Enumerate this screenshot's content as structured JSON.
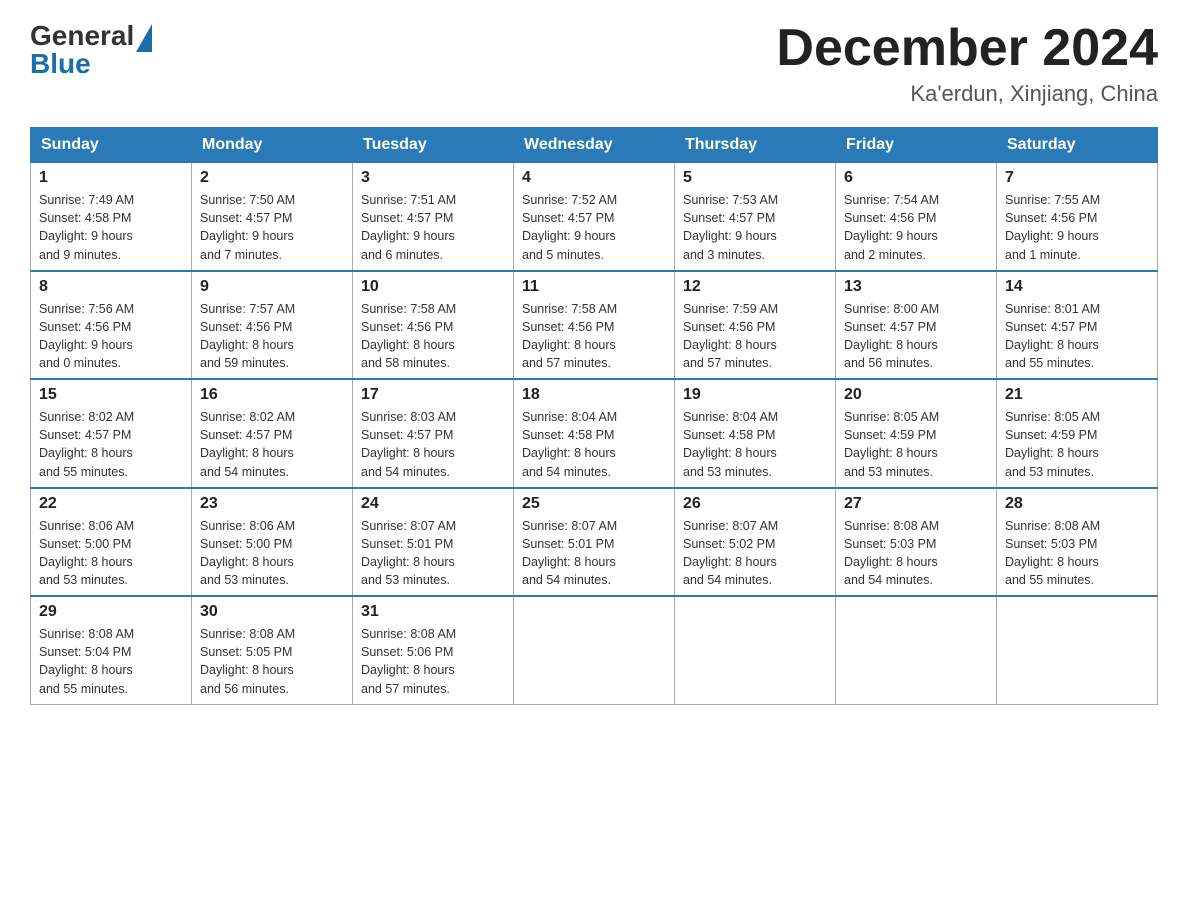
{
  "logo": {
    "general": "General",
    "blue": "Blue"
  },
  "title": "December 2024",
  "subtitle": "Ka'erdun, Xinjiang, China",
  "days_of_week": [
    "Sunday",
    "Monday",
    "Tuesday",
    "Wednesday",
    "Thursday",
    "Friday",
    "Saturday"
  ],
  "weeks": [
    [
      {
        "day": "1",
        "info": "Sunrise: 7:49 AM\nSunset: 4:58 PM\nDaylight: 9 hours\nand 9 minutes."
      },
      {
        "day": "2",
        "info": "Sunrise: 7:50 AM\nSunset: 4:57 PM\nDaylight: 9 hours\nand 7 minutes."
      },
      {
        "day": "3",
        "info": "Sunrise: 7:51 AM\nSunset: 4:57 PM\nDaylight: 9 hours\nand 6 minutes."
      },
      {
        "day": "4",
        "info": "Sunrise: 7:52 AM\nSunset: 4:57 PM\nDaylight: 9 hours\nand 5 minutes."
      },
      {
        "day": "5",
        "info": "Sunrise: 7:53 AM\nSunset: 4:57 PM\nDaylight: 9 hours\nand 3 minutes."
      },
      {
        "day": "6",
        "info": "Sunrise: 7:54 AM\nSunset: 4:56 PM\nDaylight: 9 hours\nand 2 minutes."
      },
      {
        "day": "7",
        "info": "Sunrise: 7:55 AM\nSunset: 4:56 PM\nDaylight: 9 hours\nand 1 minute."
      }
    ],
    [
      {
        "day": "8",
        "info": "Sunrise: 7:56 AM\nSunset: 4:56 PM\nDaylight: 9 hours\nand 0 minutes."
      },
      {
        "day": "9",
        "info": "Sunrise: 7:57 AM\nSunset: 4:56 PM\nDaylight: 8 hours\nand 59 minutes."
      },
      {
        "day": "10",
        "info": "Sunrise: 7:58 AM\nSunset: 4:56 PM\nDaylight: 8 hours\nand 58 minutes."
      },
      {
        "day": "11",
        "info": "Sunrise: 7:58 AM\nSunset: 4:56 PM\nDaylight: 8 hours\nand 57 minutes."
      },
      {
        "day": "12",
        "info": "Sunrise: 7:59 AM\nSunset: 4:56 PM\nDaylight: 8 hours\nand 57 minutes."
      },
      {
        "day": "13",
        "info": "Sunrise: 8:00 AM\nSunset: 4:57 PM\nDaylight: 8 hours\nand 56 minutes."
      },
      {
        "day": "14",
        "info": "Sunrise: 8:01 AM\nSunset: 4:57 PM\nDaylight: 8 hours\nand 55 minutes."
      }
    ],
    [
      {
        "day": "15",
        "info": "Sunrise: 8:02 AM\nSunset: 4:57 PM\nDaylight: 8 hours\nand 55 minutes."
      },
      {
        "day": "16",
        "info": "Sunrise: 8:02 AM\nSunset: 4:57 PM\nDaylight: 8 hours\nand 54 minutes."
      },
      {
        "day": "17",
        "info": "Sunrise: 8:03 AM\nSunset: 4:57 PM\nDaylight: 8 hours\nand 54 minutes."
      },
      {
        "day": "18",
        "info": "Sunrise: 8:04 AM\nSunset: 4:58 PM\nDaylight: 8 hours\nand 54 minutes."
      },
      {
        "day": "19",
        "info": "Sunrise: 8:04 AM\nSunset: 4:58 PM\nDaylight: 8 hours\nand 53 minutes."
      },
      {
        "day": "20",
        "info": "Sunrise: 8:05 AM\nSunset: 4:59 PM\nDaylight: 8 hours\nand 53 minutes."
      },
      {
        "day": "21",
        "info": "Sunrise: 8:05 AM\nSunset: 4:59 PM\nDaylight: 8 hours\nand 53 minutes."
      }
    ],
    [
      {
        "day": "22",
        "info": "Sunrise: 8:06 AM\nSunset: 5:00 PM\nDaylight: 8 hours\nand 53 minutes."
      },
      {
        "day": "23",
        "info": "Sunrise: 8:06 AM\nSunset: 5:00 PM\nDaylight: 8 hours\nand 53 minutes."
      },
      {
        "day": "24",
        "info": "Sunrise: 8:07 AM\nSunset: 5:01 PM\nDaylight: 8 hours\nand 53 minutes."
      },
      {
        "day": "25",
        "info": "Sunrise: 8:07 AM\nSunset: 5:01 PM\nDaylight: 8 hours\nand 54 minutes."
      },
      {
        "day": "26",
        "info": "Sunrise: 8:07 AM\nSunset: 5:02 PM\nDaylight: 8 hours\nand 54 minutes."
      },
      {
        "day": "27",
        "info": "Sunrise: 8:08 AM\nSunset: 5:03 PM\nDaylight: 8 hours\nand 54 minutes."
      },
      {
        "day": "28",
        "info": "Sunrise: 8:08 AM\nSunset: 5:03 PM\nDaylight: 8 hours\nand 55 minutes."
      }
    ],
    [
      {
        "day": "29",
        "info": "Sunrise: 8:08 AM\nSunset: 5:04 PM\nDaylight: 8 hours\nand 55 minutes."
      },
      {
        "day": "30",
        "info": "Sunrise: 8:08 AM\nSunset: 5:05 PM\nDaylight: 8 hours\nand 56 minutes."
      },
      {
        "day": "31",
        "info": "Sunrise: 8:08 AM\nSunset: 5:06 PM\nDaylight: 8 hours\nand 57 minutes."
      },
      {
        "day": "",
        "info": ""
      },
      {
        "day": "",
        "info": ""
      },
      {
        "day": "",
        "info": ""
      },
      {
        "day": "",
        "info": ""
      }
    ]
  ]
}
